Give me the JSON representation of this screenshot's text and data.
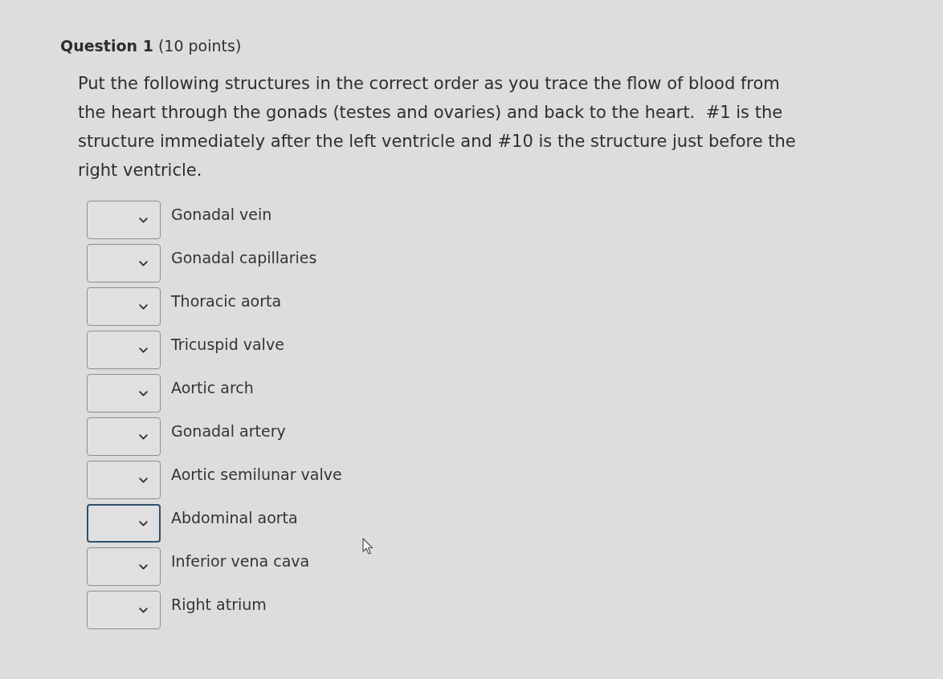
{
  "question": {
    "title": "Question 1",
    "points": "(10 points)",
    "prompt": "Put the following structures in the correct order as you trace the flow of blood from the heart through the gonads (testes and ovaries) and back to the heart.  #1 is the structure immediately after the left ventricle and #10 is the structure just before the right ventricle."
  },
  "items": [
    {
      "label": "Gonadal vein",
      "focused": false
    },
    {
      "label": "Gonadal capillaries",
      "focused": false
    },
    {
      "label": "Thoracic aorta",
      "focused": false
    },
    {
      "label": "Tricuspid valve",
      "focused": false
    },
    {
      "label": "Aortic arch",
      "focused": false
    },
    {
      "label": "Gonadal artery",
      "focused": false
    },
    {
      "label": "Aortic semilunar valve",
      "focused": false
    },
    {
      "label": "Abdominal aorta",
      "focused": true
    },
    {
      "label": "Inferior vena cava",
      "focused": false
    },
    {
      "label": "Right atrium",
      "focused": false
    }
  ]
}
